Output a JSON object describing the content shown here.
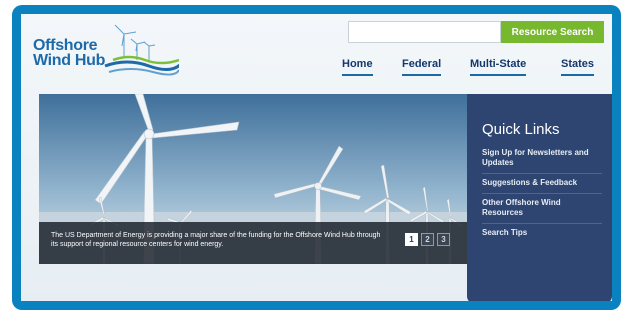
{
  "header": {
    "logo": {
      "line1": "Offshore",
      "line2": "Wind Hub"
    },
    "search": {
      "placeholder": "",
      "button_label": "Resource Search"
    },
    "nav": [
      {
        "label": "Home"
      },
      {
        "label": "Federal"
      },
      {
        "label": "Multi-State"
      },
      {
        "label": "States"
      }
    ]
  },
  "hero": {
    "caption": "The US Department of Energy is providing a major share of the funding for the Offshore Wind Hub through its support of regional resource centers for wind energy.",
    "pages": [
      "1",
      "2",
      "3"
    ],
    "active_page": 1
  },
  "quick_links": {
    "title": "Quick Links",
    "items": [
      {
        "label": "Sign Up for Newsletters and Updates"
      },
      {
        "label": "Suggestions & Feedback"
      },
      {
        "label": "Other Offshore Wind Resources"
      },
      {
        "label": "Search Tips"
      }
    ]
  },
  "colors": {
    "frame": "#0a82c0",
    "accent_green": "#78b82e",
    "nav_text": "#14386e",
    "panel": "#2d4570"
  }
}
